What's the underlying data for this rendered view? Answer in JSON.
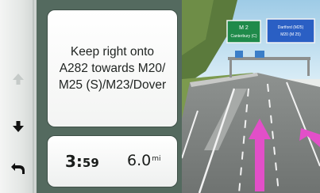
{
  "instruction": {
    "text": "Keep right onto\nA282 towards M20/\nM25 (S)/M23/Dover"
  },
  "trip": {
    "eta_hours": "3:",
    "eta_minutes": "59",
    "distance": "6.0",
    "distance_unit": "mi"
  },
  "signs": {
    "left_line1": "M 2",
    "left_line2": "Canterbury (C)",
    "right_line1": "Dartford (M25)",
    "right_line2": "M20 (M 25)"
  },
  "icons": {
    "up": "up-arrow-icon",
    "down": "down-arrow-icon",
    "back": "back-arrow-icon"
  },
  "colors": {
    "panel": "#546a5f",
    "route_arrow": "#e24fc8",
    "sign_green": "#1f8a4a",
    "sign_blue": "#2a5fc4"
  }
}
